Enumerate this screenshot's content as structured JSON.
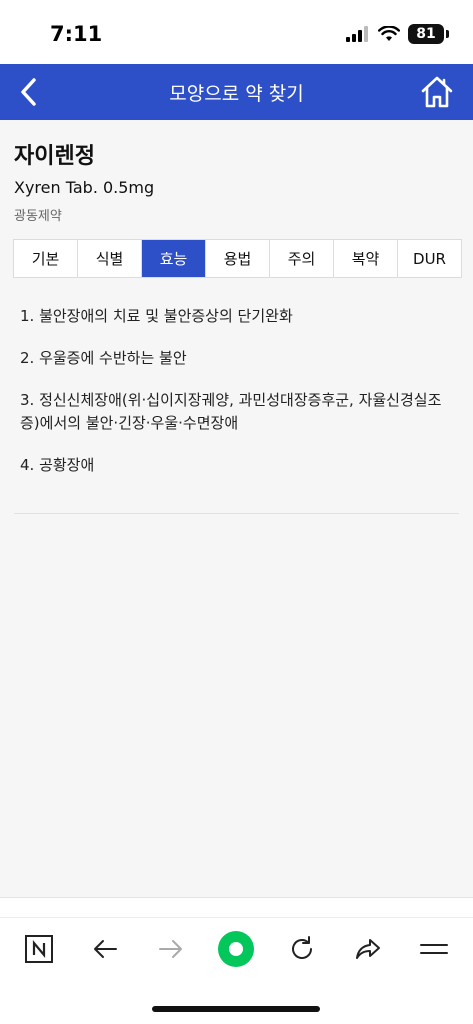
{
  "status_bar": {
    "time": "7:11",
    "battery": "81"
  },
  "header": {
    "title": "모양으로 약 찾기"
  },
  "drug": {
    "name_ko": "자이렌정",
    "name_en": "Xyren Tab. 0.5mg",
    "maker": "광동제약"
  },
  "tabs": [
    {
      "label": "기본"
    },
    {
      "label": "식별"
    },
    {
      "label": "효능"
    },
    {
      "label": "용법"
    },
    {
      "label": "주의"
    },
    {
      "label": "복약"
    },
    {
      "label": "DUR"
    }
  ],
  "active_tab": "효능",
  "efficacy": [
    "1. 불안장애의 치료 및 불안증상의 단기완화",
    "2. 우울증에 수반하는 불안",
    "3. 정신신체장애(위·십이지장궤양, 과민성대장증후군, 자율신경실조증)에서의 불안·긴장·우울·수면장애",
    "4. 공황장애"
  ],
  "colors": {
    "brand": "#2d4fc8",
    "naver_green": "#03c75a"
  },
  "toolbar_icons": [
    "naver-n-icon",
    "back-arrow-icon",
    "forward-arrow-icon",
    "green-dot-icon",
    "refresh-icon",
    "share-icon",
    "menu-icon"
  ]
}
